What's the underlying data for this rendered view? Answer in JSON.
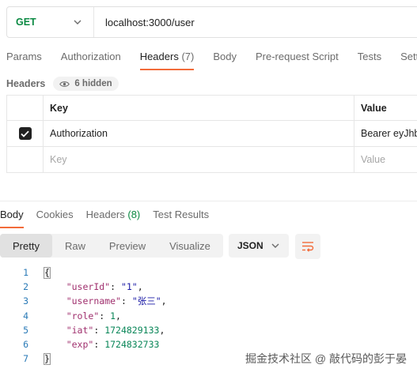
{
  "request": {
    "method": "GET",
    "url": "localhost:3000/user"
  },
  "request_tabs": [
    {
      "label": "Params",
      "count": ""
    },
    {
      "label": "Authorization",
      "count": ""
    },
    {
      "label": "Headers",
      "count": "(7)"
    },
    {
      "label": "Body",
      "count": ""
    },
    {
      "label": "Pre-request Script",
      "count": ""
    },
    {
      "label": "Tests",
      "count": ""
    },
    {
      "label": "Setti",
      "count": ""
    }
  ],
  "headers_section": {
    "title": "Headers",
    "hidden_label": "6 hidden",
    "columns": {
      "key": "Key",
      "value": "Value"
    },
    "rows": [
      {
        "key": "Authorization",
        "value": "Bearer eyJhb",
        "checked": true
      }
    ],
    "placeholder": {
      "key": "Key",
      "value": "Value"
    }
  },
  "response_tabs": [
    {
      "label": "Body",
      "count": ""
    },
    {
      "label": "Cookies",
      "count": ""
    },
    {
      "label": "Headers",
      "count": "(8)"
    },
    {
      "label": "Test Results",
      "count": ""
    }
  ],
  "view_modes": [
    "Pretty",
    "Raw",
    "Preview",
    "Visualize"
  ],
  "format": "JSON",
  "code": {
    "line_numbers": [
      "1",
      "2",
      "3",
      "4",
      "5",
      "6",
      "7"
    ],
    "open": "{",
    "close": "}",
    "fields": [
      {
        "key": "\"userId\"",
        "value": "\"1\"",
        "type": "string",
        "comma": ","
      },
      {
        "key": "\"username\"",
        "value": "\"张三\"",
        "type": "string",
        "comma": ","
      },
      {
        "key": "\"role\"",
        "value": "1",
        "type": "number",
        "comma": ","
      },
      {
        "key": "\"iat\"",
        "value": "1724829133",
        "type": "number",
        "comma": ","
      },
      {
        "key": "\"exp\"",
        "value": "1724832733",
        "type": "number",
        "comma": ""
      }
    ]
  },
  "watermark": "掘金技术社区 @ 敲代码的彭于晏",
  "colors": {
    "accent": "#f26b3a",
    "get_method": "#0b8a43",
    "line_numbers": "#2a7ab7"
  }
}
